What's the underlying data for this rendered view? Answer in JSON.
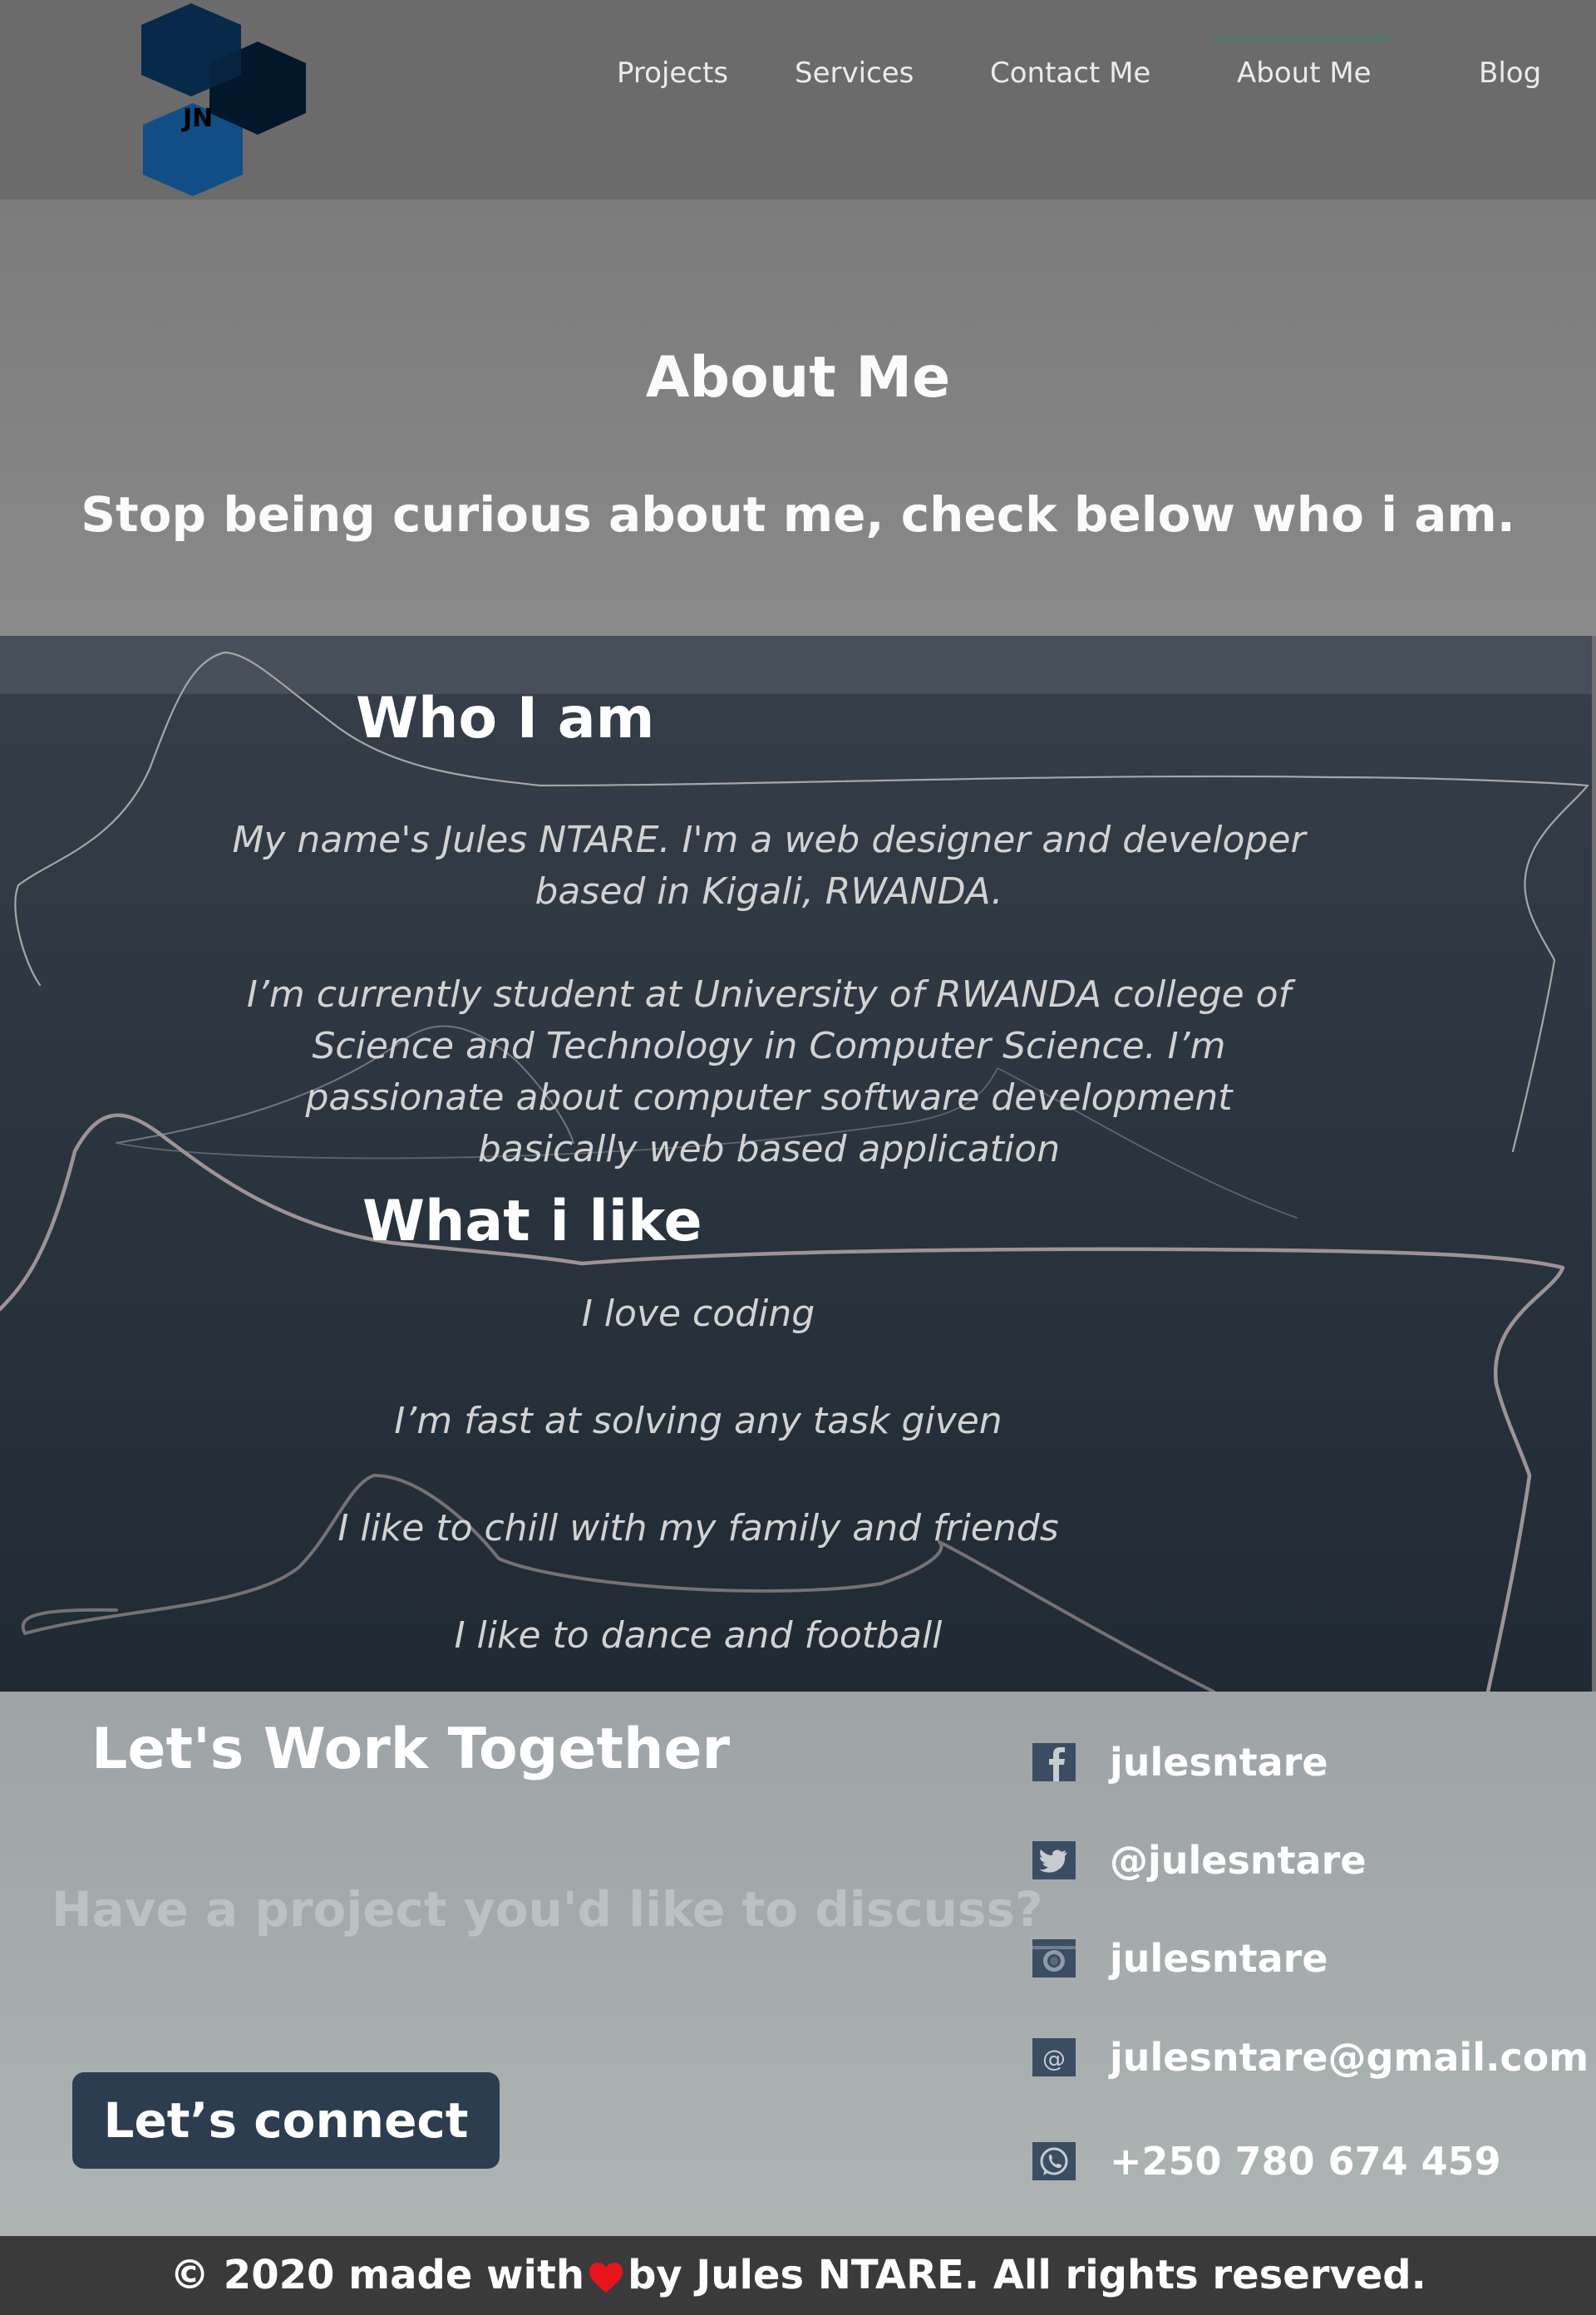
{
  "logo": {
    "text": "JN"
  },
  "nav": {
    "items": [
      {
        "label": "Projects"
      },
      {
        "label": "Services"
      },
      {
        "label": "Contact Me"
      },
      {
        "label": "About Me"
      },
      {
        "label": "Blog"
      }
    ],
    "active": "About Me"
  },
  "hero": {
    "title": "About Me",
    "subtitle": "Stop being curious about me, check below who i am."
  },
  "about": {
    "who_title": "Who I am",
    "paragraphs": [
      "My name's Jules NTARE. I'm a web designer and developer based in Kigali, RWANDA.",
      "I’m currently student at University of RWANDA college of Science and Technology in Computer Science. I’m passionate about computer software development basically web based application"
    ],
    "like_title": "What i like",
    "likes": [
      "I love coding",
      "I’m fast at solving any task given",
      "I like to chill with my family and friends",
      "I like to dance and football"
    ]
  },
  "contact": {
    "title": "Let's Work Together",
    "question": "Have a project you'd like to discuss?",
    "button": "Let’s connect",
    "socials": [
      {
        "icon": "facebook-icon",
        "text": "julesntare"
      },
      {
        "icon": "twitter-icon",
        "text": "@julesntare"
      },
      {
        "icon": "instagram-icon",
        "text": "julesntare"
      },
      {
        "icon": "email-icon",
        "text": "julesntare@gmail.com"
      },
      {
        "icon": "whatsapp-icon",
        "text": "+250 780 674 459"
      }
    ]
  },
  "footer": {
    "before": "© 2020 made with",
    "after": "by Jules NTARE. All rights reserved."
  },
  "colors": {
    "nav_bg": "#6b6b6b",
    "hero_bg": "#828282",
    "about_bg": "#2a3440",
    "contact_bg": "#a4aaac",
    "button_bg": "#2c3d4f",
    "footer_bg": "#3a3a3a",
    "heart": "#e8141c",
    "logo_dark": "#062540",
    "logo_blue": "#114e86"
  }
}
